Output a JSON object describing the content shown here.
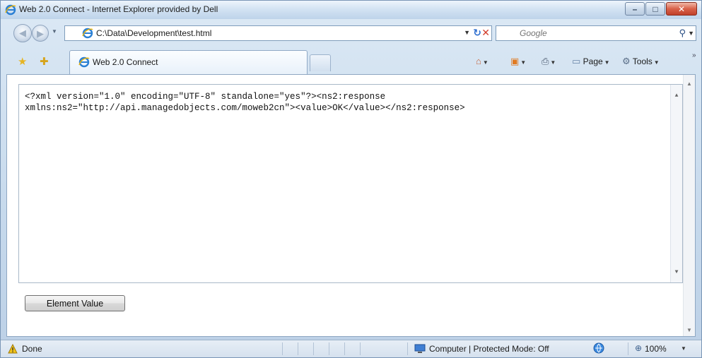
{
  "window": {
    "title": "Web 2.0 Connect - Internet Explorer provided by Dell"
  },
  "address_bar": {
    "url": "C:\\Data\\Development\\test.html",
    "search_placeholder": "Google"
  },
  "tab": {
    "label": "Web 2.0 Connect"
  },
  "command_bar": {
    "page_label": "Page",
    "tools_label": "Tools"
  },
  "content": {
    "xml_lines": [
      "<?xml version=\"1.0\" encoding=\"UTF-8\" standalone=\"yes\"?><ns2:response",
      "xmlns:ns2=\"http://api.managedobjects.com/moweb2cn\"><value>OK</value></ns2:response>"
    ],
    "button_label": "Element Value"
  },
  "status_bar": {
    "status": "Done",
    "zone": "Computer | Protected Mode: Off",
    "zoom": "100%"
  },
  "colors": {
    "chrome": "#c6d9ec",
    "close_button": "#d9624a",
    "accent_blue": "#2f6fcf"
  },
  "icons": {
    "browser": "ie-icon",
    "back": "back-arrow-icon",
    "forward": "forward-arrow-icon",
    "refresh": "refresh-icon",
    "stop": "stop-icon",
    "search": "search-icon",
    "favorites": "favorites-star-icon",
    "add_favorite": "add-favorite-icon",
    "home": "home-icon",
    "feeds": "feeds-icon",
    "print": "print-icon",
    "warning": "warning-icon",
    "zone": "computer-zone-icon",
    "protected_mode": "globe-icon",
    "zoom": "zoom-icon"
  }
}
